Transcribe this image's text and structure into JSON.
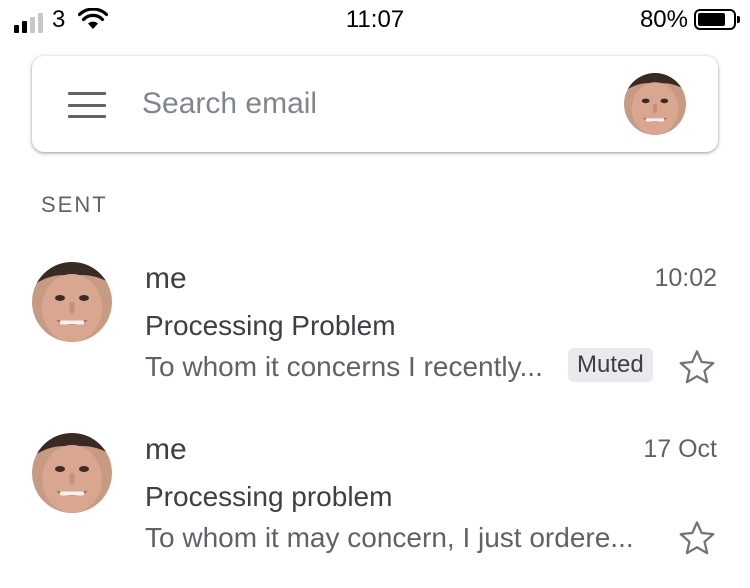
{
  "status_bar": {
    "carrier": "3",
    "time": "11:07",
    "battery_percent": "80%",
    "battery_level": 0.8,
    "signal_bars": 2,
    "icons": [
      "signal-icon",
      "wifi-icon",
      "battery-icon"
    ]
  },
  "search": {
    "placeholder": "Search email",
    "value": "",
    "icons": [
      "menu-icon",
      "avatar"
    ]
  },
  "section": {
    "label": "SENT"
  },
  "emails": [
    {
      "sender": "me",
      "date": "10:02",
      "subject": "Processing Problem",
      "snippet": "To whom it concerns I recently...",
      "badge": "Muted",
      "starred": false
    },
    {
      "sender": "me",
      "date": "17 Oct",
      "subject": "Processing problem",
      "snippet": "To whom it may concern, I just ordere...",
      "badge": "",
      "starred": false
    }
  ],
  "colors": {
    "icon_gray": "#5f6368",
    "badge_bg": "#e8eaed",
    "text_primary": "#3c4043",
    "text_secondary": "#5f6368"
  }
}
